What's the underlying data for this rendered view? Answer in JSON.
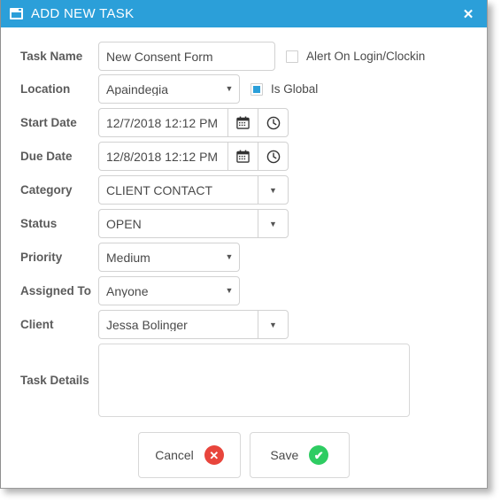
{
  "window": {
    "title": "ADD NEW TASK",
    "title_icon": "window-icon",
    "close_label": "✕",
    "titlebar_color": "#2b9fd9"
  },
  "form": {
    "rows": [
      {
        "label": "Task Name",
        "value": "New Consent Form",
        "control": "text"
      },
      {
        "label": "Location",
        "value": "Apaindegia",
        "control": "combo-inner"
      },
      {
        "label": "Start Date",
        "value": "12/7/2018 12:12 PM",
        "control": "date"
      },
      {
        "label": "Due Date",
        "value": "12/8/2018 12:12 PM",
        "control": "date"
      },
      {
        "label": "Category",
        "value": "CLIENT CONTACT",
        "control": "combo-split"
      },
      {
        "label": "Status",
        "value": "OPEN",
        "control": "combo-split"
      },
      {
        "label": "Priority",
        "value": "Medium",
        "control": "combo-inner"
      },
      {
        "label": "Assigned To",
        "value": "Anyone",
        "control": "combo-inner"
      },
      {
        "label": "Client",
        "value": "Jessa Bolinger",
        "control": "combo-split"
      }
    ],
    "checkboxes": {
      "alert_on_login": {
        "label": "Alert On Login/Clockin",
        "checked": false
      },
      "is_global": {
        "label": "Is Global",
        "checked": true
      }
    },
    "details": {
      "label": "Task Details",
      "value": "",
      "placeholder": ""
    },
    "caret_glyph": "▼"
  },
  "footer": {
    "cancel": {
      "label": "Cancel",
      "icon": "cancel-circle-icon",
      "glyph": "✕",
      "color": "#e8453c"
    },
    "save": {
      "label": "Save",
      "icon": "check-circle-icon",
      "glyph": "✔",
      "color": "#2ecc62"
    }
  }
}
